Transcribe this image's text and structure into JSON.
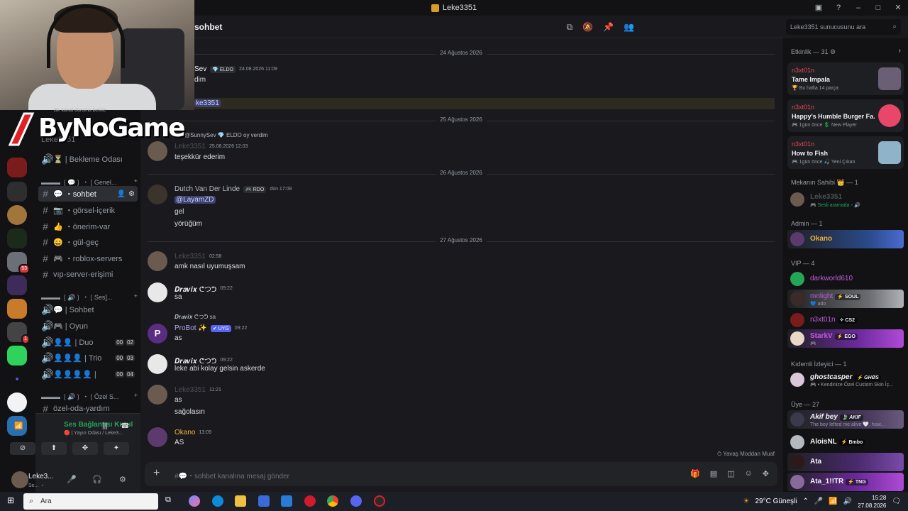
{
  "window": {
    "title": "Leke3351",
    "controls": [
      "▣",
      "?",
      "–",
      "□",
      "✕"
    ]
  },
  "logo": {
    "text": "ByNoGame",
    "status_hint": "Bir kanal durumu belirle"
  },
  "rail": {
    "badges": [
      "53",
      "1"
    ]
  },
  "sidebar": {
    "faded_user": "Leke3351",
    "channels": [
      {
        "id": "bekleme",
        "icon": "🔊",
        "label": "⏳ | Bekleme Odası"
      },
      {
        "id": "cat-genel",
        "label": "▬▬▬ ❲💬❳ ・❲Genel..."
      },
      {
        "id": "sohbet",
        "icon": "#",
        "label": "💬 ・sohbet"
      },
      {
        "id": "gorsel",
        "icon": "#",
        "label": "📷 ・görsel-içerik"
      },
      {
        "id": "onerim",
        "icon": "#",
        "label": "👍 ・önerim-var"
      },
      {
        "id": "gulgec",
        "icon": "#",
        "label": "😄 ・gül-geç"
      },
      {
        "id": "roblox",
        "icon": "#",
        "label": "🎮 ・roblox-servers"
      },
      {
        "id": "vip",
        "icon": "#",
        "label": "vıp-server-erişimi"
      },
      {
        "id": "cat-ses",
        "label": "▬▬▬ ❲🔊❳ ・❲Ses]..."
      },
      {
        "id": "vsohbet",
        "icon": "🔊",
        "label": "💬 | Sohbet"
      },
      {
        "id": "voyun",
        "icon": "🔊",
        "label": "🎮 | Oyun"
      },
      {
        "id": "vduo",
        "icon": "🔊",
        "label": "👤👤 | Duo",
        "counts": [
          "00",
          "02"
        ]
      },
      {
        "id": "vtrio",
        "icon": "🔊",
        "label": "👤👤👤 | Trio",
        "counts": [
          "00",
          "03"
        ]
      },
      {
        "id": "vquad",
        "icon": "🔊",
        "label": "👤👤👤👤 |",
        "counts": [
          "00",
          "04"
        ]
      },
      {
        "id": "cat-ozel",
        "label": "▬▬▬ ❲🔊❳ ・❲Özel S..."
      },
      {
        "id": "ozel",
        "icon": "#",
        "label": "özel-oda-yardım"
      }
    ],
    "voice": {
      "status": "Ses Bağlantısı Kurul",
      "sub": "🔴 | Yayın Odası / Leke3..."
    },
    "user": {
      "name": "Leke3...",
      "sub": "Se... ・"
    }
  },
  "chat": {
    "channel_name": "sohbet",
    "search_placeholder": "Leke3351 sunucusunu ara",
    "composer_placeholder": "sohbet kanalına mesaj gönder",
    "slowmode": "Yavaş Moddan Muaf",
    "dates": [
      "24 Ağustos 2026",
      "25 Ağustos 2026",
      "26 Ağustos 2026",
      "27 Ağustos 2026"
    ],
    "messages": [
      {
        "author": "Sev",
        "tag": "💎 ELDO",
        "time": "24.08.2026 11:09",
        "lines": [
          "dim"
        ]
      },
      {
        "mention_line": "ke3351"
      },
      {
        "reply": "@SunnySev 💎 ELDO  oy verdim",
        "author": "Leke3351",
        "time": "25.08.2026 12:03",
        "lines": [
          "teşekkür ederim"
        ]
      },
      {
        "author": "Dutch Van Der Linde",
        "tag": "🎮 RDO",
        "time": "dün 17:08",
        "mention": "@LayamZD",
        "lines": [
          "gel",
          "yörüğüm"
        ]
      },
      {
        "author": "Leke3351",
        "time": "02:58",
        "lines": [
          "amk nasıl uyumuşsam"
        ]
      },
      {
        "author": "𝑫𝒓𝒂𝒗𝒊𝒙 ᕦつᕤ",
        "time": "09:22",
        "lines": [
          "sa"
        ]
      },
      {
        "reply": "𝑫𝒓𝒂𝒗𝒊𝒙 ᕦつᕤ  sa",
        "author": "ProBot ✨",
        "tag": "✔ UYG",
        "time": "09:22",
        "lines": [
          "as"
        ]
      },
      {
        "author": "𝑫𝒓𝒂𝒗𝒊𝒙 ᕦつᕤ",
        "time": "09:22",
        "lines": [
          "leke abi kolay gelsin askerde"
        ]
      },
      {
        "author": "Leke3351",
        "time": "11:21",
        "lines": [
          "as",
          "sağolasın"
        ]
      },
      {
        "author": "Okano",
        "time": "13:09",
        "lines": [
          "AS"
        ]
      }
    ]
  },
  "members": {
    "activity_title": "Etkinlik — 31 ⚙",
    "activities": [
      {
        "who": "n3xt01n",
        "what": "Tame Impala",
        "det": "🏆 Bu hafta 14 parça"
      },
      {
        "who": "n3xt01n",
        "what": "Happy's Humble Burger Fa...",
        "det": "🎮 1gün önce  💲 New Player"
      },
      {
        "who": "n3xt01n",
        "what": "How to Fish",
        "det": "🎮 1gün önce  🎣 Yeni Çıkan"
      }
    ],
    "sections": [
      {
        "title": "Mekanın Sahibi 👑 — 1",
        "people": [
          {
            "name": "Leke3351",
            "sub": "🎮 Sesli aramada・🔊"
          }
        ]
      },
      {
        "title": "Admin — 1",
        "people": [
          {
            "name": "Okano"
          }
        ]
      },
      {
        "title": "VIP — 4",
        "people": [
          {
            "name": "darkworld610"
          },
          {
            "name": "mnlight",
            "tag": "⚡ SOUL",
            "sub": "💙 ado"
          },
          {
            "name": "n3xt01n",
            "tag": "✧ CS2"
          },
          {
            "name": "StarkV",
            "tag": "⚡ EGO",
            "sub": "🎮"
          }
        ]
      },
      {
        "title": "Kıdemli İzleyici — 1",
        "people": [
          {
            "name": "ghostcasper",
            "tag": "⚡ GHØS",
            "sub": "🎮 • Kendinize Özel Custom Skin İç..."
          }
        ]
      },
      {
        "title": "Üye — 27",
        "people": [
          {
            "name": "Akif bey",
            "tag": "🍃 AKIF",
            "sub": "The boy lefted me alive 🤍, how..."
          },
          {
            "name": "AloisNL",
            "tag": "⚡ Bmbo"
          },
          {
            "name": "Ata"
          },
          {
            "name": "Ata_1!!TR",
            "tag": "⚡ TNG"
          }
        ]
      }
    ]
  },
  "taskbar": {
    "search": "Ara",
    "weather": "29°C  Güneşli",
    "time": "15:28",
    "date": "27.08.2026"
  },
  "colors": {
    "accent": "#5865f2",
    "online": "#23a55a",
    "mention_bg": "#3c4270",
    "okano": "#f0b232"
  }
}
